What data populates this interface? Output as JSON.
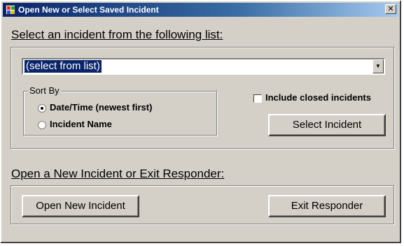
{
  "window": {
    "title": "Open New or Select Saved Incident",
    "close_glyph": "✕",
    "app_icon": "app-icon"
  },
  "select_section": {
    "heading": "Select an incident from the following list:",
    "incident_combo": {
      "value": "(select from list)",
      "arrow_glyph": "▼"
    },
    "sort_by": {
      "legend": "Sort By",
      "options": [
        {
          "label": "Date/Time (newest first)",
          "selected": true
        },
        {
          "label": "Incident Name",
          "selected": false
        }
      ]
    },
    "include_closed": {
      "label": "Include closed incidents",
      "checked": false
    },
    "select_button": "Select Incident"
  },
  "open_section": {
    "heading": "Open a New Incident or Exit Responder:",
    "open_button": "Open New Incident",
    "exit_button": "Exit Responder"
  }
}
